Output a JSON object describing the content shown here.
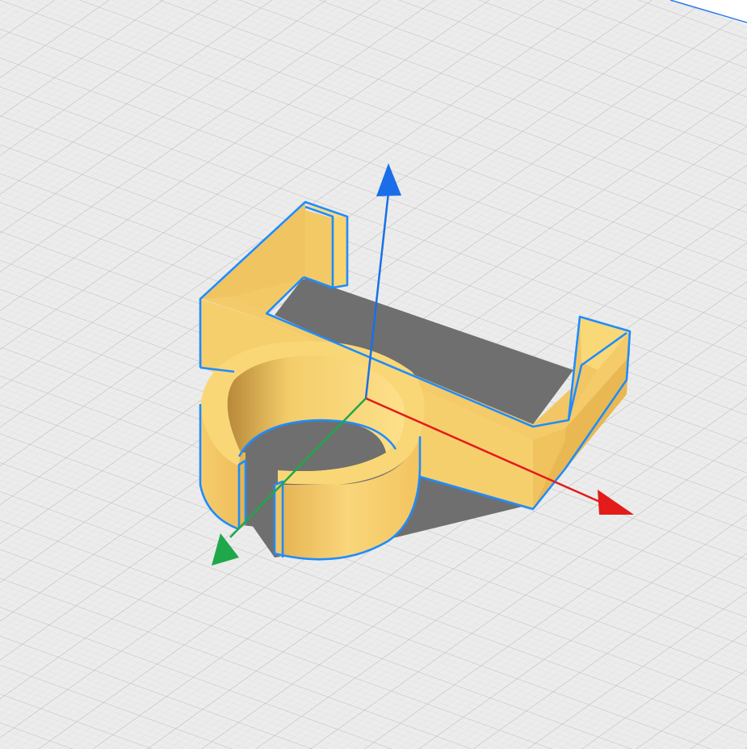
{
  "viewport": {
    "background": "#eeeeee",
    "grid_color": "#c4c4c4",
    "grid_minor_color": "#d9d9d9"
  },
  "model": {
    "kind": "selected 3D part (U-bracket with split ring clamp)",
    "top_color": "#f9d872",
    "side_color": "#f3c863",
    "shade_color": "#e0aa48",
    "outline_color": "#1f8cff",
    "shadow_color": "#6e6e6e",
    "selected": true
  },
  "gizmo": {
    "x_axis": {
      "color": "#e31b1b",
      "icon": "arrow-x-icon"
    },
    "y_axis": {
      "color": "#1ea84a",
      "icon": "arrow-y-icon"
    },
    "z_axis": {
      "color": "#1a6fe8",
      "icon": "arrow-z-icon"
    }
  }
}
